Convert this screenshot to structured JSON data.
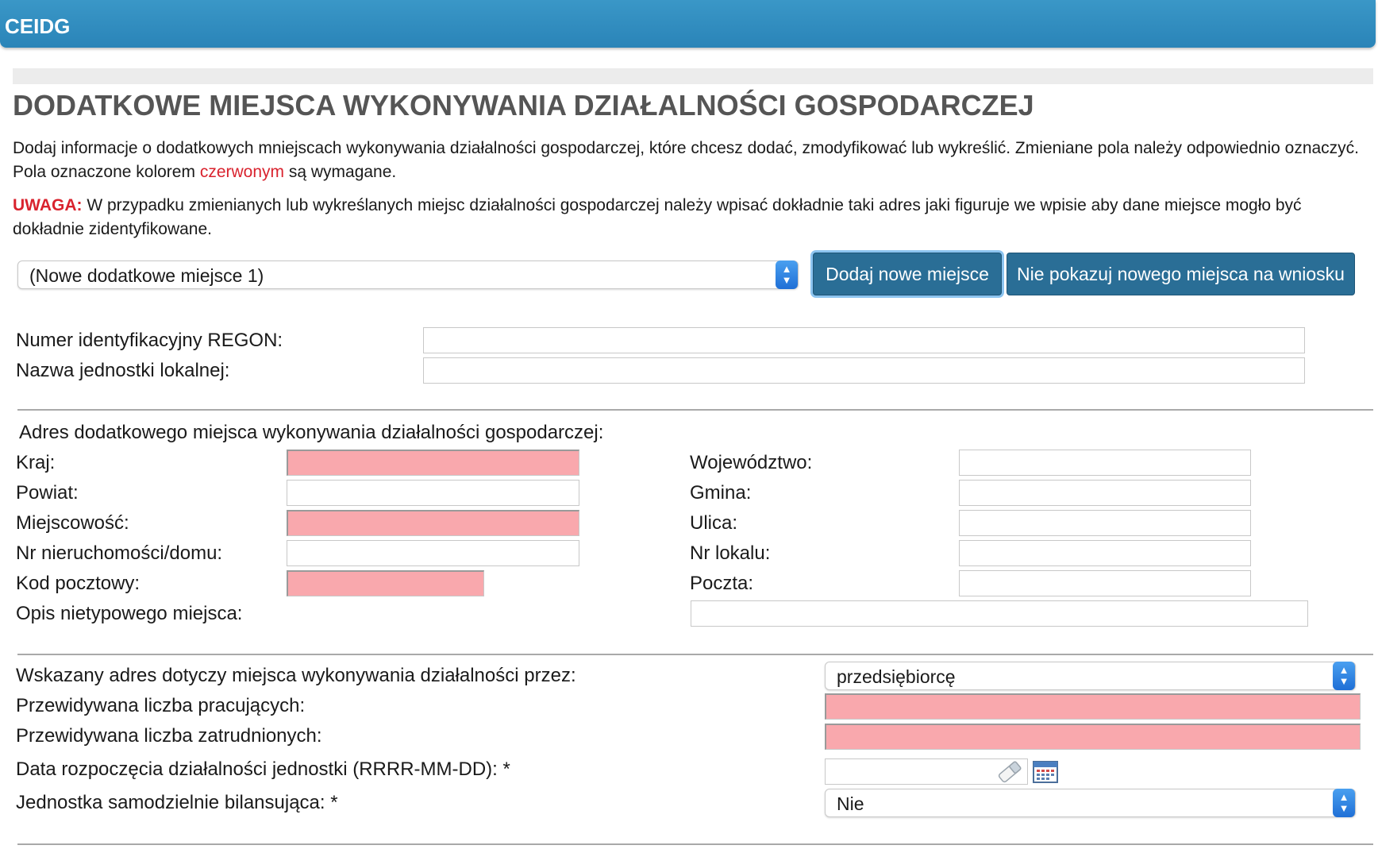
{
  "header": {
    "app_title": "CEIDG"
  },
  "page": {
    "title": "DODATKOWE MIEJSCA WYKONYWANIA DZIAŁALNOŚCI GOSPODARCZEJ",
    "intro_part1": "Dodaj informacje o dodatkowych mniejscach wykonywania działalności gospodarczej, które chcesz dodać, zmodyfikować lub wykreślić. Zmieniane pola należy odpowiednio oznaczyć. Pola oznaczone kolorem ",
    "intro_red_word": "czerwonym",
    "intro_part2": " są wymagane.",
    "warning_label": "UWAGA:",
    "warning_text": " W przypadku zmienianych lub wykreślanych miejsc działalności gospodarczej należy wpisać dokładnie taki adres jaki figuruje we wpisie aby dane miejsce mogło być dokładnie zidentyfikowane."
  },
  "place_selector": {
    "selected": "(Nowe dodatkowe miejsce 1)",
    "add_button": "Dodaj nowe miejsce",
    "hide_button": "Nie pokazuj nowego miejsca na wniosku"
  },
  "identification": {
    "regon_label": "Numer identyfikacyjny REGON:",
    "regon_value": "",
    "unit_name_label": "Nazwa jednostki lokalnej:",
    "unit_name_value": ""
  },
  "address": {
    "section_label": "Adres dodatkowego miejsca wykonywania działalności gospodarczej:",
    "kraj_label": "Kraj:",
    "wojewodztwo_label": "Województwo:",
    "powiat_label": "Powiat:",
    "gmina_label": "Gmina:",
    "miejscowosc_label": "Miejscowość:",
    "ulica_label": "Ulica:",
    "nr_domu_label": "Nr nieruchomości/domu:",
    "nr_lokalu_label": "Nr lokalu:",
    "kod_label": "Kod pocztowy:",
    "poczta_label": "Poczta:",
    "opis_label": "Opis nietypowego miejsca:"
  },
  "details": {
    "dotyczy_label": "Wskazany adres dotyczy miejsca wykonywania działalności przez:",
    "dotyczy_value": "przedsiębiorcę",
    "pracujacych_label": "Przewidywana liczba pracujących:",
    "zatrudnionych_label": "Przewidywana liczba zatrudnionych:",
    "data_label": "Data rozpoczęcia działalności jednostki (RRRR-MM-DD): *",
    "data_value": "",
    "bilansujaca_label": "Jednostka samodzielnie bilansująca: *",
    "bilansujaca_value": "Nie"
  },
  "colors": {
    "header_blue": "#2a84b8",
    "button_blue": "#2a6e96",
    "required_pink": "#f9a8ad",
    "required_text_red": "#d9232e",
    "title_grey": "#555555"
  },
  "icons": [
    "eraser-icon",
    "calendar-icon",
    "select-updown-arrow-icon"
  ]
}
